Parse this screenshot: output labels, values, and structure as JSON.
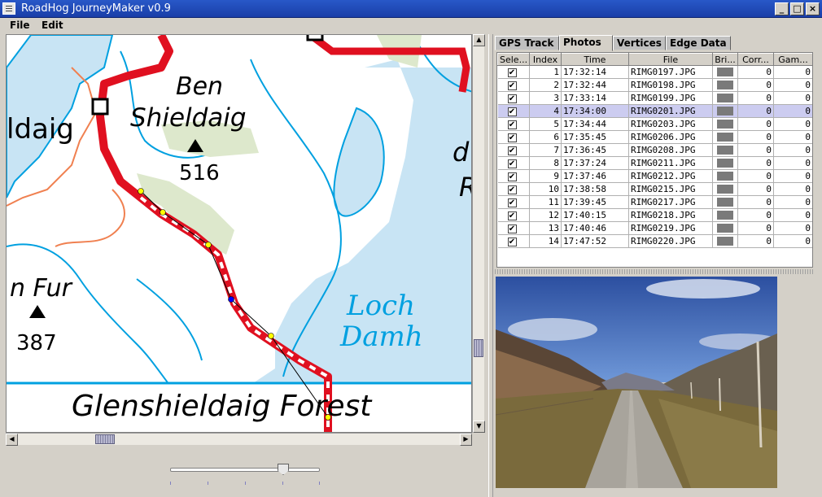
{
  "window": {
    "title": "RoadHog JourneyMaker v0.9",
    "minimize_label": "_",
    "maximize_label": "□",
    "close_label": "×"
  },
  "menu": [
    "File",
    "Edit"
  ],
  "map": {
    "labels": {
      "ben": "Ben",
      "shieldaig_hill": "Shieldaig",
      "summit_516": "516",
      "idaig": "ldaig",
      "fur": "n Fur",
      "summit_387": "387",
      "loch": "Loch",
      "damh": "Damh",
      "forest": "Glenshieldaig Forest",
      "right_d": "d",
      "right_r": "R"
    }
  },
  "tabs": [
    {
      "label": "GPS Track",
      "active": false
    },
    {
      "label": "Photos",
      "active": true
    },
    {
      "label": "Vertices",
      "active": false
    },
    {
      "label": "Edge Data",
      "active": false
    }
  ],
  "photos_table": {
    "columns": [
      "Sele...",
      "Index",
      "Time",
      "File",
      "Bri...",
      "Corr...",
      "Gam..."
    ],
    "rows": [
      {
        "index": "1",
        "time": "17:32:14",
        "file": "RIMG0197.JPG",
        "corr": "0",
        "gam": "0",
        "selected": false
      },
      {
        "index": "2",
        "time": "17:32:44",
        "file": "RIMG0198.JPG",
        "corr": "0",
        "gam": "0",
        "selected": false
      },
      {
        "index": "3",
        "time": "17:33:14",
        "file": "RIMG0199.JPG",
        "corr": "0",
        "gam": "0",
        "selected": false
      },
      {
        "index": "4",
        "time": "17:34:00",
        "file": "RIMG0201.JPG",
        "corr": "0",
        "gam": "0",
        "selected": true
      },
      {
        "index": "5",
        "time": "17:34:44",
        "file": "RIMG0203.JPG",
        "corr": "0",
        "gam": "0",
        "selected": false
      },
      {
        "index": "6",
        "time": "17:35:45",
        "file": "RIMG0206.JPG",
        "corr": "0",
        "gam": "0",
        "selected": false
      },
      {
        "index": "7",
        "time": "17:36:45",
        "file": "RIMG0208.JPG",
        "corr": "0",
        "gam": "0",
        "selected": false
      },
      {
        "index": "8",
        "time": "17:37:24",
        "file": "RIMG0211.JPG",
        "corr": "0",
        "gam": "0",
        "selected": false
      },
      {
        "index": "9",
        "time": "17:37:46",
        "file": "RIMG0212.JPG",
        "corr": "0",
        "gam": "0",
        "selected": false
      },
      {
        "index": "10",
        "time": "17:38:58",
        "file": "RIMG0215.JPG",
        "corr": "0",
        "gam": "0",
        "selected": false
      },
      {
        "index": "11",
        "time": "17:39:45",
        "file": "RIMG0217.JPG",
        "corr": "0",
        "gam": "0",
        "selected": false
      },
      {
        "index": "12",
        "time": "17:40:15",
        "file": "RIMG0218.JPG",
        "corr": "0",
        "gam": "0",
        "selected": false
      },
      {
        "index": "13",
        "time": "17:40:46",
        "file": "RIMG0219.JPG",
        "corr": "0",
        "gam": "0",
        "selected": false
      },
      {
        "index": "14",
        "time": "17:47:52",
        "file": "RIMG0220.JPG",
        "corr": "0",
        "gam": "0",
        "selected": false
      }
    ]
  },
  "colors": {
    "title_bar": "#2858c8",
    "selected_row": "#ccccf0",
    "map_road": "#e01020",
    "map_water": "#c8e4f4",
    "map_contour": "#00a0e0"
  },
  "icons": {
    "checkbox": "check-icon",
    "brightness": "brightness-swatch"
  }
}
